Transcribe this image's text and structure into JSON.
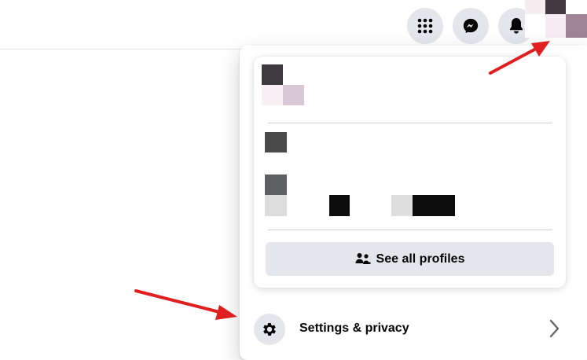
{
  "topbar": {
    "icons": {
      "menu": "grid-menu-icon",
      "messenger": "messenger-icon",
      "notifications": "bell-icon",
      "account": "profile-avatar"
    }
  },
  "profile_menu": {
    "see_all_profiles_label": "See all profiles",
    "settings_label": "Settings & privacy",
    "icons": {
      "see_all": "profiles-icon",
      "settings": "gear-icon",
      "settings_chevron": "chevron-right-icon"
    }
  },
  "colors": {
    "icon_button_bg": "#e4e6eb",
    "annotation_arrow": "#e02020",
    "text": "#050505"
  }
}
